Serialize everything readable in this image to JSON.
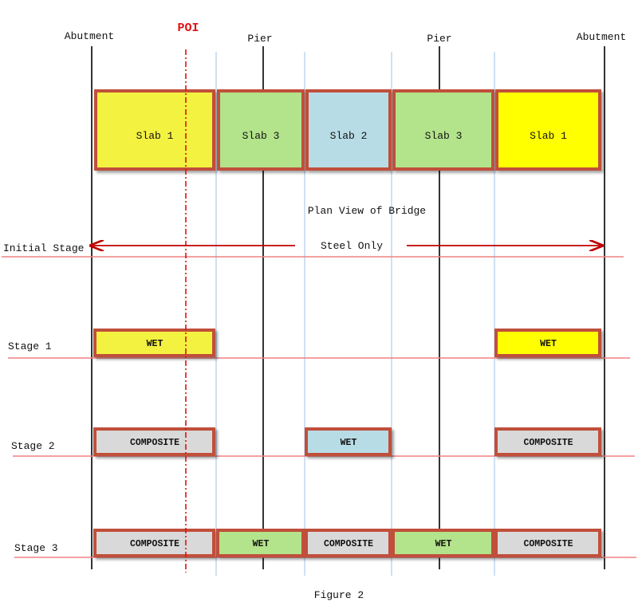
{
  "figure_caption": "Figure 2",
  "poi_label": "POI",
  "supports": [
    {
      "label": "Abutment"
    },
    {
      "label": "Pier"
    },
    {
      "label": "Pier"
    },
    {
      "label": "Abutment"
    }
  ],
  "plan_view": {
    "caption": "Plan View of Bridge",
    "slabs": [
      {
        "label": "Slab 1",
        "color": "#f4f240"
      },
      {
        "label": "Slab 3",
        "color": "#b3e38a"
      },
      {
        "label": "Slab 2",
        "color": "#b8dce6"
      },
      {
        "label": "Slab 3",
        "color": "#b3e38a"
      },
      {
        "label": "Slab 1",
        "color": "#ffff00"
      }
    ]
  },
  "stages": [
    {
      "label": "Initial Stage",
      "note": "Steel Only",
      "boxes": []
    },
    {
      "label": "Stage 1",
      "boxes": [
        {
          "segment": 0,
          "text": "WET",
          "color": "#f4f240"
        },
        {
          "segment": 4,
          "text": "WET",
          "color": "#ffff00"
        }
      ]
    },
    {
      "label": "Stage 2",
      "boxes": [
        {
          "segment": 0,
          "text": "COMPOSITE",
          "color": "#d9d9d9"
        },
        {
          "segment": 2,
          "text": "WET",
          "color": "#b8dce6"
        },
        {
          "segment": 4,
          "text": "COMPOSITE",
          "color": "#d9d9d9"
        }
      ]
    },
    {
      "label": "Stage 3",
      "boxes": [
        {
          "segment": 0,
          "text": "COMPOSITE",
          "color": "#d9d9d9"
        },
        {
          "segment": 1,
          "text": "WET",
          "color": "#b3e38a"
        },
        {
          "segment": 2,
          "text": "COMPOSITE",
          "color": "#d9d9d9"
        },
        {
          "segment": 3,
          "text": "WET",
          "color": "#b3e38a"
        },
        {
          "segment": 4,
          "text": "COMPOSITE",
          "color": "#d9d9d9"
        }
      ]
    }
  ],
  "colors": {
    "box_border": "#c0503a",
    "stage_line": "#f08080",
    "poi_line": "#e01010",
    "arrow": "#c00000",
    "slab_joint_line": "#c5d9ee"
  }
}
